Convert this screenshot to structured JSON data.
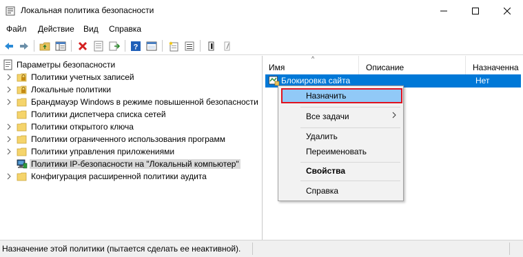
{
  "window": {
    "title": "Локальная политика безопасности"
  },
  "menu": {
    "items": [
      "Файл",
      "Действие",
      "Вид",
      "Справка"
    ]
  },
  "toolbar": {
    "icons": [
      "back-arrow-icon",
      "forward-arrow-icon",
      "up-folder-icon",
      "show-hide-tree-icon",
      "delete-icon",
      "properties-icon",
      "export-icon",
      "help-icon",
      "console-icon",
      "new-policy-icon",
      "manage-filters-icon",
      "assign-icon",
      "unassign-icon"
    ]
  },
  "tree": {
    "root": "Параметры безопасности",
    "items": [
      {
        "label": "Политики учетных записей",
        "icon": "folder-lock-icon"
      },
      {
        "label": "Локальные политики",
        "icon": "folder-lock-icon"
      },
      {
        "label": "Брандмауэр Windows в режиме повышенной безопасности",
        "icon": "folder-icon"
      },
      {
        "label": "Политики диспетчера списка сетей",
        "icon": "folder-icon"
      },
      {
        "label": "Политики открытого ключа",
        "icon": "folder-icon"
      },
      {
        "label": "Политики ограниченного использования программ",
        "icon": "folder-icon"
      },
      {
        "label": "Политики управления приложениями",
        "icon": "folder-icon"
      },
      {
        "label": "Политики IP-безопасности на \"Локальный компьютер\"",
        "icon": "ipsec-icon"
      },
      {
        "label": "Конфигурация расширенной политики аудита",
        "icon": "folder-icon"
      }
    ]
  },
  "list": {
    "columns": [
      "Имя",
      "Описание",
      "Назначенна"
    ],
    "rows": [
      {
        "name": "Блокировка сайта",
        "description": "",
        "assigned": "Нет"
      }
    ]
  },
  "context_menu": {
    "items": {
      "assign": "Назначить",
      "all_tasks": "Все задачи",
      "delete": "Удалить",
      "rename": "Переименовать",
      "properties": "Свойства",
      "help": "Справка"
    }
  },
  "status": {
    "text": "Назначение этой политики (пытается сделать ее неактивной)."
  },
  "colors": {
    "selection": "#0078d7",
    "menu_highlight": "#91c9f7",
    "highlight_border": "#e0121e"
  }
}
